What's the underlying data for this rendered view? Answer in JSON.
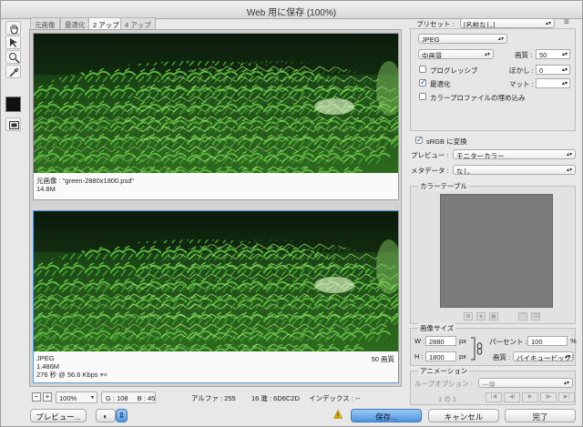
{
  "window": {
    "title": "Web 用に保存 (100%)"
  },
  "toolbox": {
    "tools": [
      {
        "name": "hand-tool-icon"
      },
      {
        "name": "slice-select-tool-icon"
      },
      {
        "name": "zoom-tool-icon"
      },
      {
        "name": "eyedropper-tool-icon"
      }
    ],
    "color_swatch": "#111111"
  },
  "tabs": [
    {
      "label": "元画像",
      "active": false
    },
    {
      "label": "最適化",
      "active": false
    },
    {
      "label": "2 アップ",
      "active": true
    },
    {
      "label": "4 アップ",
      "active": false
    }
  ],
  "panes": {
    "original": {
      "caption": "元画像 : \"green-2880x1800.psd\"",
      "size": "14.8M"
    },
    "optimized": {
      "format": "JPEG",
      "size": "1.486M",
      "time": "276 秒 @ 56.6 Kbps",
      "menu_glyph": "▾≡",
      "quality_label": "50 画質"
    }
  },
  "statusbar": {
    "zoom_out": "−",
    "zoom_in": "+",
    "zoom": "100%",
    "zoom_arrow": "▾",
    "g": "G : 108",
    "b": "B : 45",
    "alpha": "アルファ : 255",
    "hex": "16 進 : 6D6C2D",
    "index": "インデックス : --"
  },
  "bottom_buttons": {
    "preview": "プレビュー...",
    "browser_glyph": "◐",
    "browser_arrow": "⇕",
    "warn_glyph": "!",
    "save": "保存...",
    "cancel": "キャンセル",
    "done": "完了"
  },
  "settings": {
    "preset_label": "プリセット :",
    "preset_value": "[名前なし]",
    "format_value": "JPEG",
    "quality_preset": "中画質",
    "quality_label": "画質 :",
    "quality_value": "50",
    "progressive_label": "プログレッシブ",
    "progressive_checked": false,
    "blur_label": "ぼかし :",
    "blur_value": "0",
    "optimized_label": "最適化",
    "optimized_checked": true,
    "matte_label": "マット :",
    "matte_value": "",
    "embed_profile_label": "カラープロファイルの埋め込み",
    "embed_profile_checked": false,
    "menu_glyph": "≡"
  },
  "color": {
    "srgb_label": "sRGB に変換",
    "srgb_checked": true,
    "preview_label": "プレビュー :",
    "preview_value": "モニターカラー",
    "metadata_label": "メタデータ :",
    "metadata_value": "なし"
  },
  "color_table": {
    "title": "カラーテーブル",
    "swatch_color": "#7b7b7b"
  },
  "image_size": {
    "title": "画像サイズ",
    "w_label": "W :",
    "w_value": "2880",
    "h_label": "H :",
    "h_value": "1800",
    "unit": "px",
    "percent_label": "パーセント :",
    "percent_value": "100",
    "percent_unit": "%",
    "quality_label": "画質 :",
    "quality_value": "バイキュービック法"
  },
  "animation": {
    "title": "アニメーション",
    "loop_label": "ループオプション :",
    "loop_value": "一度",
    "frame": "1 の 1"
  }
}
